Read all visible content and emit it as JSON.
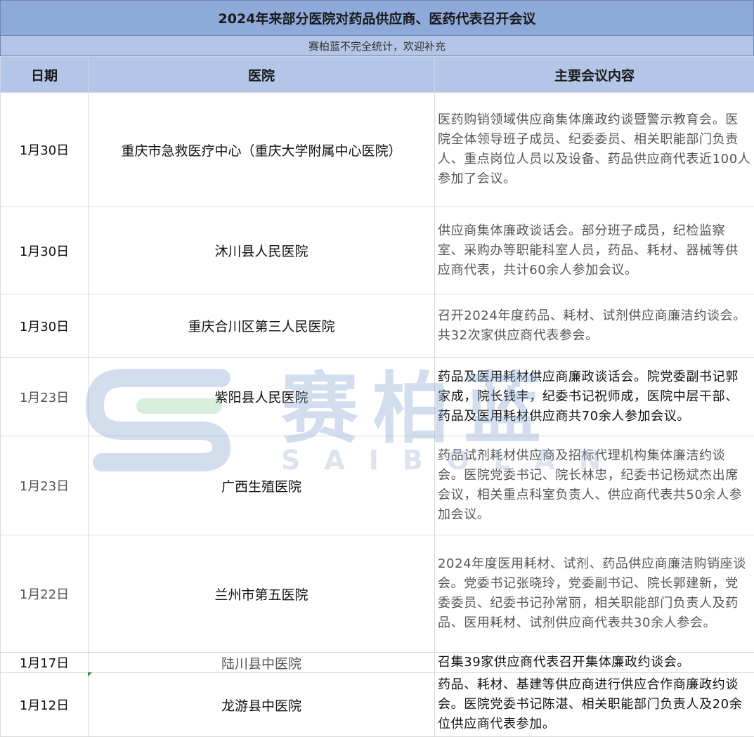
{
  "title": "2024年来部分医院对药品供应商、医药代表召开会议",
  "subtitle": "赛柏蓝不完全统计，欢迎补充",
  "headers": {
    "date": "日期",
    "hospital": "医院",
    "content": "主要会议内容"
  },
  "rows": [
    {
      "date": "1月30日",
      "hospital": "重庆市急救医疗中心（重庆大学附属中心医院）",
      "content": "医药购销领域供应商集体廉政约谈暨警示教育会。医院全体领导班子成员、纪委委员、相关职能部门负责人、重点岗位人员以及设备、药品供应商代表近100人参加了会议。"
    },
    {
      "date": "1月30日",
      "hospital": "沐川县人民医院",
      "content": "供应商集体廉政谈话会。部分班子成员，纪检监察室、采购办等职能科室人员，药品、耗材、器械等供应商代表，共计60余人参加会议。"
    },
    {
      "date": "1月30日",
      "hospital": "重庆合川区第三人民医院",
      "content": "召开2024年度药品、耗材、试剂供应商廉洁约谈会。共32次家供应商代表参会。"
    },
    {
      "date": "1月23日",
      "hospital": "紫阳县人民医院",
      "content": "药品及医用耗材供应商廉政谈话会。院党委副书记郭家成，院长钱丰，纪委书记祝师成，医院中层干部、药品及医用耗材供应商共70余人参加会议。"
    },
    {
      "date": "1月23日",
      "hospital": "广西生殖医院",
      "content": "药品试剂耗材供应商及招标代理机构集体廉洁约谈会。医院党委书记、院长林忠，纪委书记杨斌杰出席会议，相关重点科室负责人、供应商代表共50余人参加会议。"
    },
    {
      "date": "1月22日",
      "hospital": "兰州市第五医院",
      "content": "2024年度医用耗材、试剂、药品供应商廉洁购销座谈会。党委书记张晓玲，党委副书记、院长郭建新，党委委员、纪委书记孙常丽，相关职能部门负责人及药品、医用耗材、试剂供应商代表共30余人参会。"
    },
    {
      "date": "1月17日",
      "hospital": "陆川县中医院",
      "content": "召集39家供应商代表召开集体廉政约谈会。"
    },
    {
      "date": "1月12日",
      "hospital": "龙游县中医院",
      "content": "药品、耗材、基建等供应商进行供应合作商廉政约谈会。医院党委书记陈湛、相关职能部门负责人及20余位供应商代表参加。"
    }
  ],
  "watermark": {
    "cn": "赛柏蓝",
    "en": "SAIBOLAN",
    "logo_icon": "saibolan-logo-icon"
  },
  "colors": {
    "title_bg": "#8eaadb",
    "header_bg": "#b4c6e7",
    "grid": "#d9d9d9",
    "watermark_blue": "#7f9fd0",
    "watermark_green": "#8ccf9a"
  }
}
